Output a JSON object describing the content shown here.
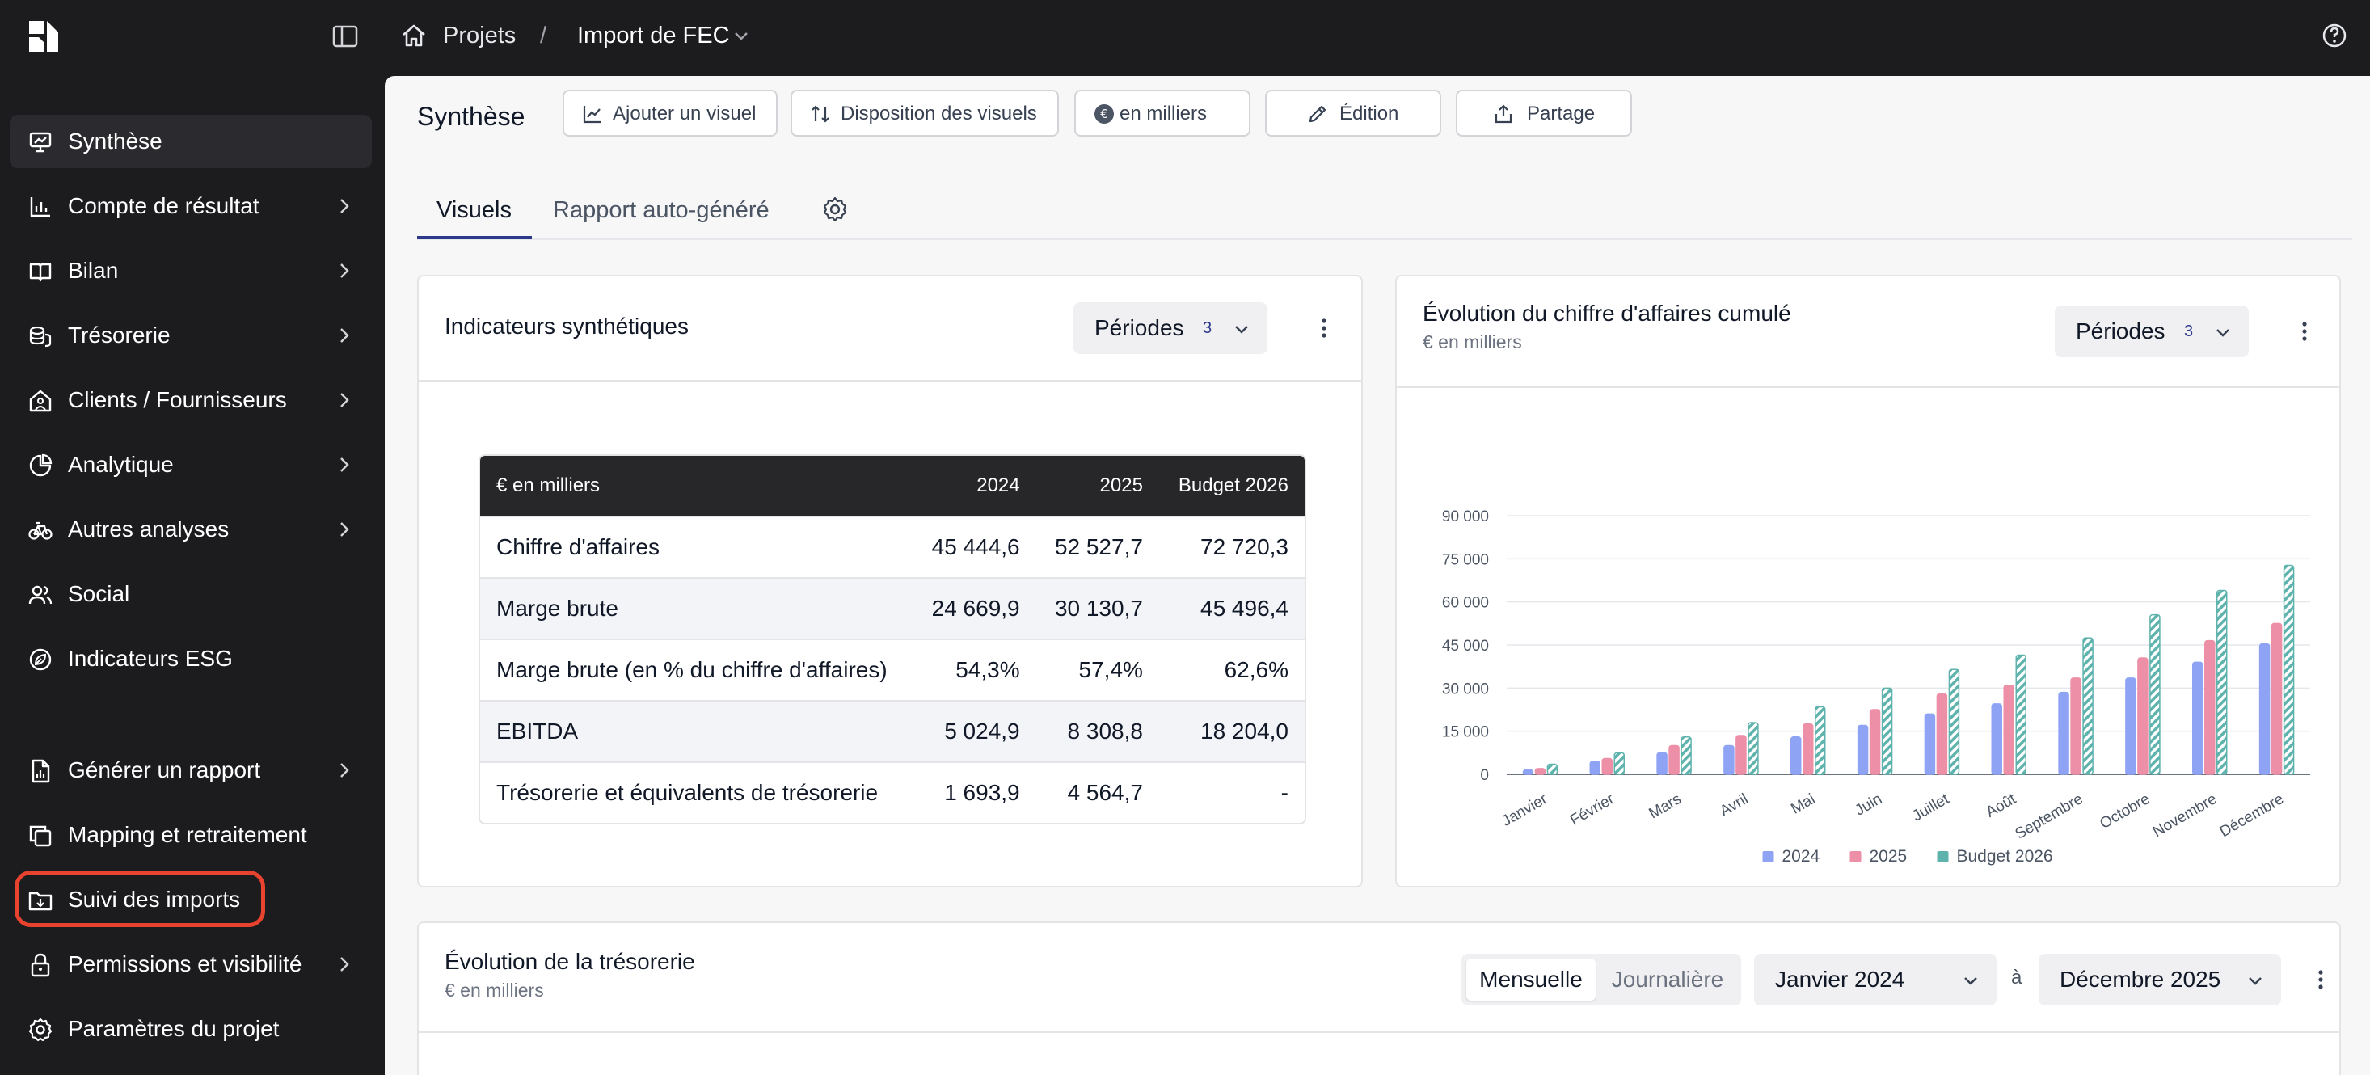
{
  "breadcrumb": {
    "projects": "Projets",
    "separator": "/",
    "current": "Import de FEC"
  },
  "sidebar": {
    "items": [
      {
        "label": "Synthèse",
        "icon": "presentation-chart-icon",
        "chevron": false,
        "active": true
      },
      {
        "label": "Compte de résultat",
        "icon": "bar-chart-icon",
        "chevron": true
      },
      {
        "label": "Bilan",
        "icon": "book-open-icon",
        "chevron": true
      },
      {
        "label": "Trésorerie",
        "icon": "coins-icon",
        "chevron": true
      },
      {
        "label": "Clients / Fournisseurs",
        "icon": "house-user-icon",
        "chevron": true
      },
      {
        "label": "Analytique",
        "icon": "pie-chart-icon",
        "chevron": true
      },
      {
        "label": "Autres analyses",
        "icon": "bicycle-icon",
        "chevron": true
      },
      {
        "label": "Social",
        "icon": "users-icon",
        "chevron": false
      },
      {
        "label": "Indicateurs ESG",
        "icon": "leaf-badge-icon",
        "chevron": false
      }
    ],
    "bottom_items": [
      {
        "label": "Générer un rapport",
        "icon": "file-chart-icon",
        "chevron": true
      },
      {
        "label": "Mapping et retraitement",
        "icon": "copy-icon",
        "chevron": false
      },
      {
        "label": "Suivi des imports",
        "icon": "folder-download-icon",
        "chevron": false
      },
      {
        "label": "Permissions et visibilité",
        "icon": "lock-icon",
        "chevron": true
      },
      {
        "label": "Paramètres du projet",
        "icon": "gear-icon",
        "chevron": false
      }
    ],
    "highlight_color": "#e8432e"
  },
  "main": {
    "title": "Synthèse",
    "toolbar": {
      "add_visual": "Ajouter un visuel",
      "layout": "Disposition des visuels",
      "currency_badge": "€",
      "units": "en milliers",
      "edit": "Édition",
      "share": "Partage"
    },
    "tabs": {
      "visuels": "Visuels",
      "rapport": "Rapport auto-généré"
    }
  },
  "kpi_card": {
    "title": "Indicateurs synthétiques",
    "periods_label": "Périodes",
    "periods_count": "3",
    "table": {
      "headers": [
        "€ en milliers",
        "2024",
        "2025",
        "Budget 2026"
      ],
      "rows": [
        [
          "Chiffre d'affaires",
          "45 444,6",
          "52 527,7",
          "72 720,3"
        ],
        [
          "Marge brute",
          "24 669,9",
          "30 130,7",
          "45 496,4"
        ],
        [
          "Marge brute (en % du chiffre d'affaires)",
          "54,3%",
          "57,4%",
          "62,6%"
        ],
        [
          "EBITDA",
          "5 024,9",
          "8 308,8",
          "18 204,0"
        ],
        [
          "Trésorerie et équivalents de trésorerie",
          "1 693,9",
          "4 564,7",
          "-"
        ]
      ]
    }
  },
  "revenue_card": {
    "title": "Évolution du chiffre d'affaires cumulé",
    "subtitle": "€ en milliers",
    "periods_label": "Périodes",
    "periods_count": "3"
  },
  "chart_data": {
    "type": "bar",
    "title": "Évolution du chiffre d'affaires cumulé",
    "subtitle": "€ en milliers",
    "categories": [
      "Janvier",
      "Février",
      "Mars",
      "Avril",
      "Mai",
      "Juin",
      "Juillet",
      "Août",
      "Septembre",
      "Octobre",
      "Novembre",
      "Décembre"
    ],
    "series": [
      {
        "name": "2024",
        "color": "#8fa3f5",
        "values": [
          1500,
          4500,
          7500,
          10000,
          13000,
          17000,
          21000,
          24500,
          28500,
          33500,
          39000,
          45400
        ]
      },
      {
        "name": "2025",
        "color": "#ec8fa7",
        "values": [
          2000,
          5500,
          10000,
          13500,
          17500,
          22500,
          28000,
          31000,
          33500,
          40500,
          46500,
          52500
        ]
      },
      {
        "name": "Budget 2026",
        "color": "#5fb3ad",
        "values": [
          3500,
          7500,
          13000,
          18000,
          23500,
          30000,
          36500,
          41500,
          47500,
          55500,
          64000,
          72700
        ],
        "pattern": "hatched"
      }
    ],
    "yticks": [
      "0",
      "15 000",
      "30 000",
      "45 000",
      "60 000",
      "75 000",
      "90 000"
    ],
    "ylim": [
      0,
      90000
    ],
    "grid": true,
    "legend": "bottom"
  },
  "treasury_card": {
    "title": "Évolution de la trésorerie",
    "subtitle": "€ en milliers",
    "toggle_monthly": "Mensuelle",
    "toggle_daily": "Journalière",
    "from": "Janvier 2024",
    "to_label": "à",
    "to": "Décembre 2025"
  }
}
